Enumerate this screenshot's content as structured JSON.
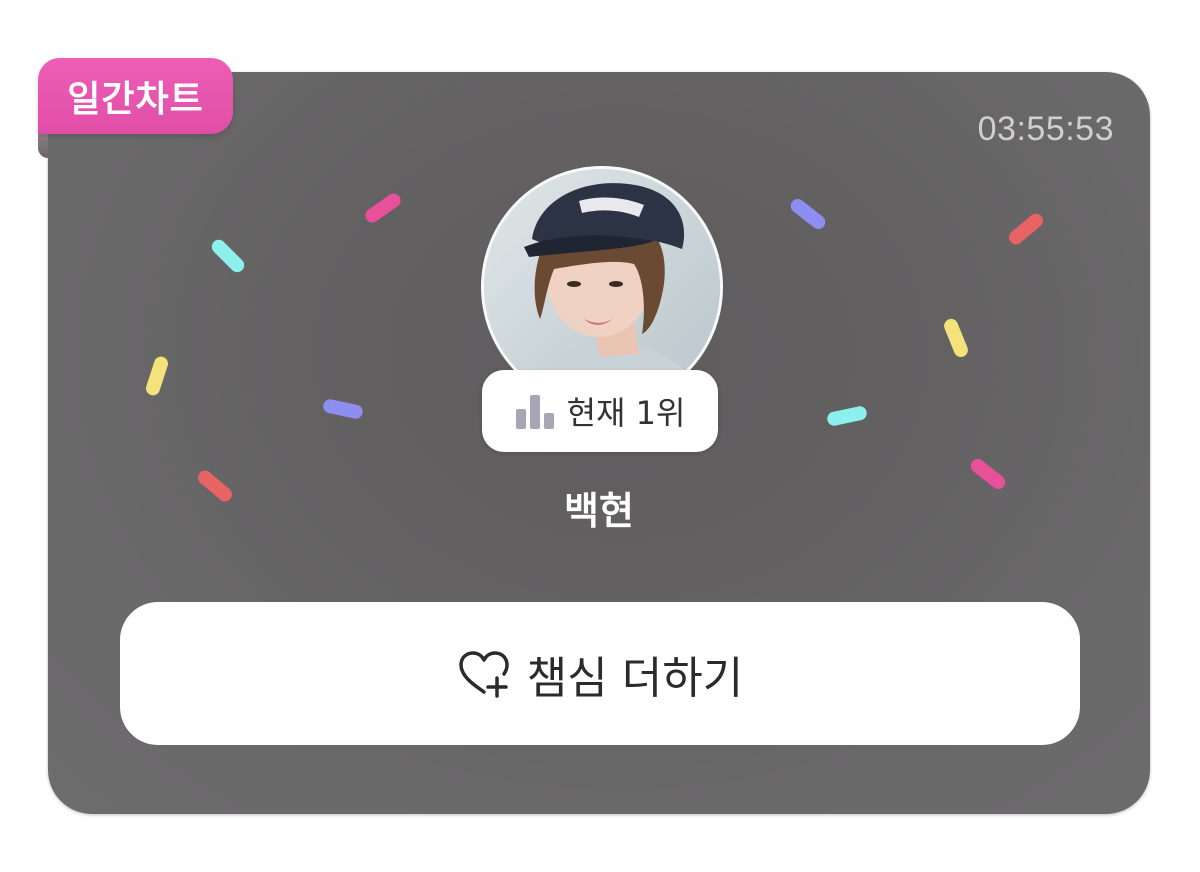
{
  "badge": {
    "label": "일간차트"
  },
  "timer": {
    "text": "03:55:53"
  },
  "artist": {
    "name": "백현",
    "rank_text": "현재 1위"
  },
  "vote_button": {
    "label": "챔심 더하기"
  },
  "colors": {
    "badge_pink": "#e853ae",
    "card_background": "#656364",
    "rank_icon": "#a8a5b6",
    "confetti_pink": "#e8509a",
    "confetti_cyan": "#8ef0ec",
    "confetti_yellow": "#f4e37a",
    "confetti_purple": "#8e8ef0",
    "confetti_red": "#e86464"
  },
  "icons": {
    "rank": "bar-chart-icon",
    "vote": "heart-plus-icon"
  }
}
